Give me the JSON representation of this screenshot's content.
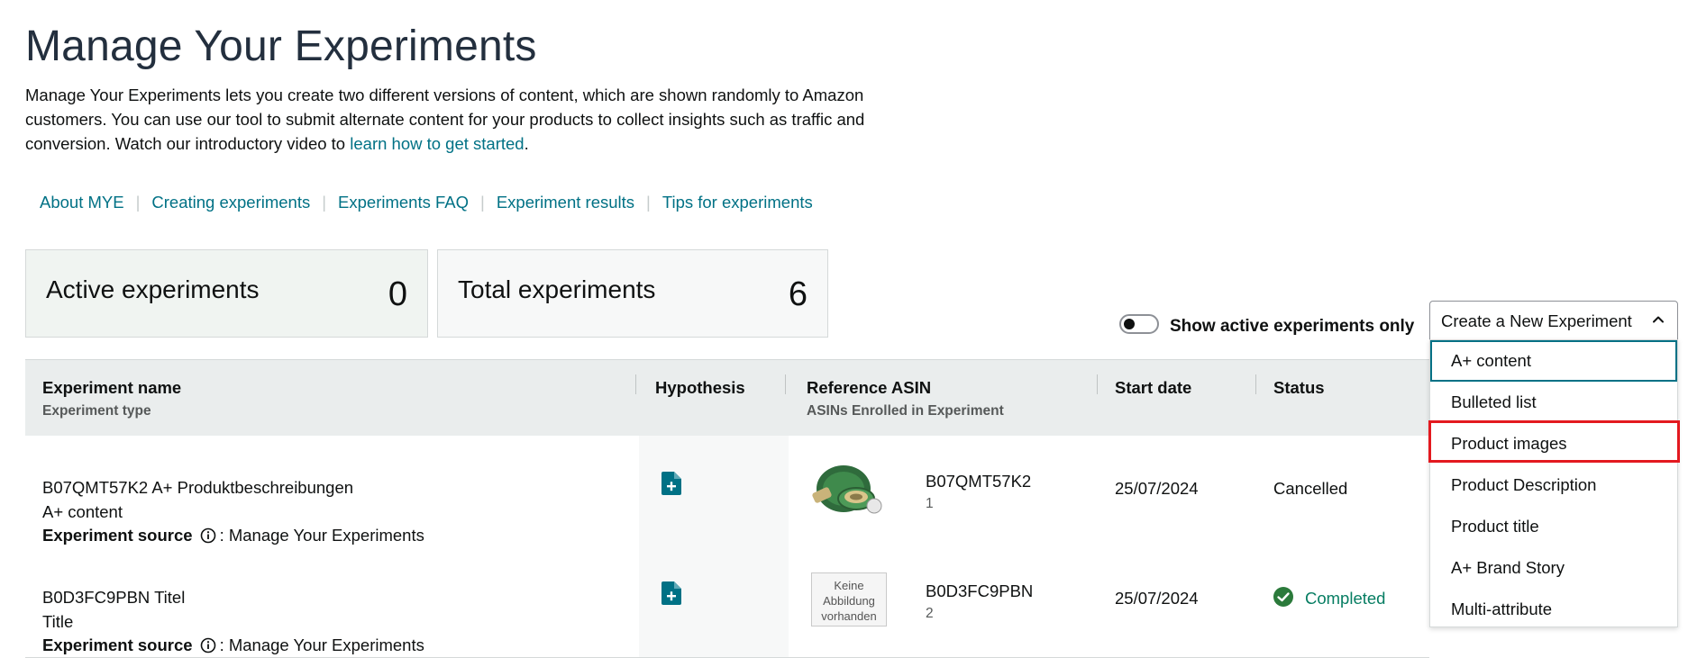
{
  "page": {
    "title": "Manage Your Experiments",
    "intro_text": "Manage Your Experiments lets you create two different versions of content, which are shown randomly to Amazon customers. You can use our tool to submit alternate content for your products to collect insights such as traffic and conversion. Watch our introductory video to ",
    "intro_link": "learn how to get started",
    "intro_end": "."
  },
  "help_links": [
    "About MYE",
    "Creating experiments",
    "Experiments FAQ",
    "Experiment results",
    "Tips for experiments"
  ],
  "stats": {
    "active_label": "Active experiments",
    "active_value": "0",
    "total_label": "Total experiments",
    "total_value": "6"
  },
  "filter": {
    "toggle_label": "Show active experiments only",
    "toggle_on": false
  },
  "create_menu": {
    "label": "Create a New Experiment",
    "expanded": true,
    "options": [
      "A+ content",
      "Bulleted list",
      "Product images",
      "Product Description",
      "Product title",
      "A+ Brand Story",
      "Multi-attribute"
    ],
    "focused_option": "A+ content",
    "highlighted_option": "Product images",
    "highlight_color": "#e3191f"
  },
  "table": {
    "headers": {
      "name": "Experiment name",
      "name_sub": "Experiment type",
      "hypothesis": "Hypothesis",
      "asin": "Reference ASIN",
      "asin_sub": "ASINs Enrolled in Experiment",
      "start": "Start date",
      "status": "Status"
    },
    "source_label": "Experiment source",
    "rows": [
      {
        "name": "B07QMT57K2 A+ Produktbeschreibungen",
        "type": "A+ content",
        "source": ": Manage Your Experiments",
        "asin": "B07QMT57K2",
        "asin_count": "1",
        "start_date": "25/07/2024",
        "status": "Cancelled",
        "status_icon": "none"
      },
      {
        "name": "B0D3FC9PBN Titel",
        "type": "Title",
        "source": ": Manage Your Experiments",
        "asin": "B0D3FC9PBN",
        "asin_count": "2",
        "thumb_text": [
          "Keine",
          "Abbildung",
          "vorhanden"
        ],
        "start_date": "25/07/2024",
        "status": "Completed",
        "status_icon": "check-circle-icon"
      }
    ]
  },
  "colors": {
    "link": "#007185",
    "header_bg": "#eaeded",
    "active_card_bg": "#f0f4f1",
    "completed_green": "#067d62",
    "check_icon": "#2b7a3b",
    "title": "#232f3e"
  }
}
